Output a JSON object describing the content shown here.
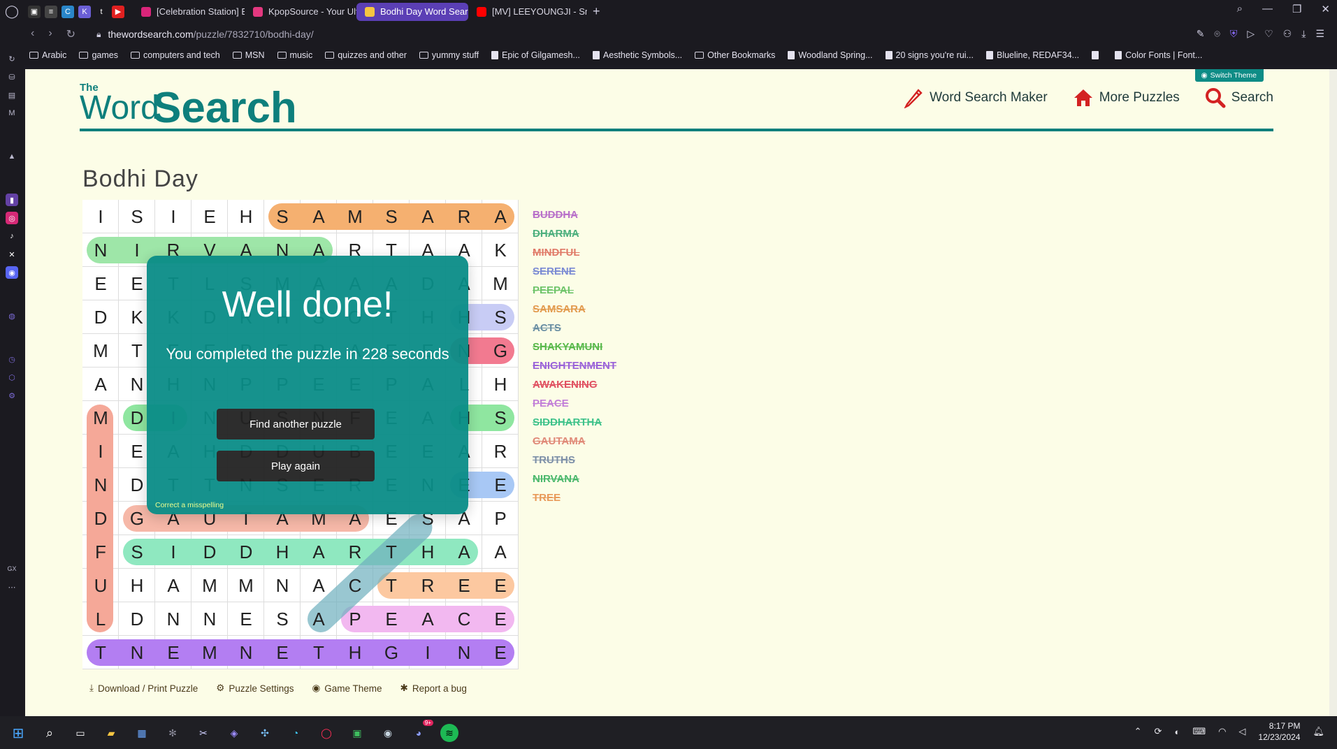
{
  "browser": {
    "tabs": [
      {
        "label": "[Celebration Station] Bodh",
        "active": false,
        "color": "#d9257a"
      },
      {
        "label": "KpopSource - Your Ultimat",
        "active": false,
        "color": "#e3387f"
      },
      {
        "label": "Bodhi Day Word Search",
        "active": true,
        "color": "#f5c542"
      },
      {
        "label": "[MV] LEEYOUNGJI - Small",
        "active": false,
        "color": "#ff0000"
      }
    ],
    "url_host": "thewordsearch.com",
    "url_path": "/puzzle/7832710/bodhi-day/",
    "bookmarks": [
      {
        "label": "Arabic",
        "type": "folder"
      },
      {
        "label": "games",
        "type": "folder"
      },
      {
        "label": "computers and tech",
        "type": "folder"
      },
      {
        "label": "MSN",
        "type": "folder"
      },
      {
        "label": "music",
        "type": "folder"
      },
      {
        "label": "quizzes and other",
        "type": "folder"
      },
      {
        "label": "yummy stuff",
        "type": "folder"
      },
      {
        "label": "Epic of Gilgamesh...",
        "type": "page"
      },
      {
        "label": "Aesthetic Symbols...",
        "type": "page"
      },
      {
        "label": "Other Bookmarks",
        "type": "folder"
      },
      {
        "label": "Woodland Spring...",
        "type": "page"
      },
      {
        "label": "20 signs you're rui...",
        "type": "page"
      },
      {
        "label": "Blueline, REDAF34...",
        "type": "page"
      },
      {
        "label": "",
        "type": "page"
      },
      {
        "label": "Color Fonts | Font...",
        "type": "page"
      }
    ]
  },
  "site": {
    "logo_the": "The",
    "logo_word": "Word",
    "logo_search": "Search",
    "switch_theme": "Switch Theme",
    "nav": {
      "maker": "Word Search Maker",
      "more": "More Puzzles",
      "search": "Search"
    }
  },
  "puzzle": {
    "title": "Bodhi Day",
    "grid": [
      "ISIEHSAMSARA",
      "NIRVANARTAAK",
      "EETLSMAAADAM",
      "DKKDRHSOTHHS",
      "MTEEPEPAEENG",
      "ANHNPPEEPALH",
      "MDINUSNFEAHS",
      "IEAHDDUBEEAR",
      "NDTTNSERENEE",
      "DGAUTAMAESAP",
      "FSIDDHARTHAA",
      "UHAMMNACTREE",
      "LDNNESAPEACE",
      "TNEMNETHGINE"
    ],
    "words": [
      {
        "word": "BUDDHA",
        "color": "#b86fc9"
      },
      {
        "word": "DHARMA",
        "color": "#4caf7d"
      },
      {
        "word": "MINDFUL",
        "color": "#e07a68"
      },
      {
        "word": "SERENE",
        "color": "#7b8bd4"
      },
      {
        "word": "PEEPAL",
        "color": "#6fc46a"
      },
      {
        "word": "SAMSARA",
        "color": "#e29a4d"
      },
      {
        "word": "ACTS",
        "color": "#6a8fa3"
      },
      {
        "word": "SHAKYAMUNI",
        "color": "#58b84a"
      },
      {
        "word": "ENIGHTENMENT",
        "color": "#9a62d8"
      },
      {
        "word": "AWAKENING",
        "color": "#e05060"
      },
      {
        "word": "PEACE",
        "color": "#c27fd8"
      },
      {
        "word": "SIDDHARTHA",
        "color": "#3fc28a"
      },
      {
        "word": "GAUTAMA",
        "color": "#e08a78"
      },
      {
        "word": "TRUTHS",
        "color": "#7d90a8"
      },
      {
        "word": "NIRVANA",
        "color": "#4bb86c"
      },
      {
        "word": "TREE",
        "color": "#e89a5a"
      }
    ]
  },
  "modal": {
    "title": "Well done!",
    "message": "You completed the puzzle in 228 seconds",
    "find_another": "Find another puzzle",
    "play_again": "Play again",
    "misspelling": "Correct a misspelling"
  },
  "footer": {
    "download": "Download / Print Puzzle",
    "settings": "Puzzle Settings",
    "theme": "Game Theme",
    "bug": "Report a bug"
  },
  "taskbar": {
    "time": "8:17 PM",
    "date": "12/23/2024",
    "badge": "9+"
  }
}
